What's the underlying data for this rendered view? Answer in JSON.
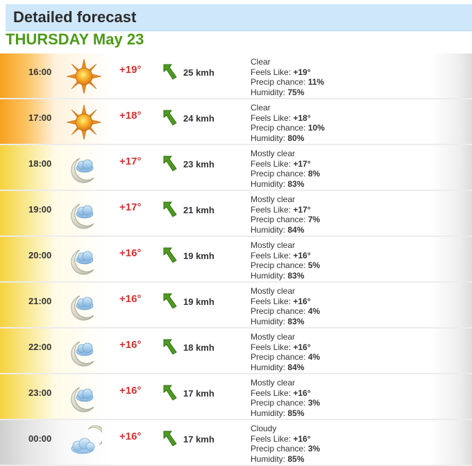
{
  "header": {
    "title": "Detailed forecast"
  },
  "day": {
    "title": "THURSDAY May 23"
  },
  "labels": {
    "feels": "Feels Like: ",
    "precip": "Precip chance: ",
    "humidity": "Humidity: "
  },
  "colors": {
    "temp": "#d0312d",
    "day_title": "#4c9a18",
    "arrow": "#4f9a21"
  },
  "rows": [
    {
      "time": "16:00",
      "icon": "sun-icon",
      "temp": "+19°",
      "wind": "25 kmh",
      "condition": "Clear",
      "feels": "+19°",
      "precip": "11%",
      "humidity": "75%"
    },
    {
      "time": "17:00",
      "icon": "sun-icon",
      "temp": "+18°",
      "wind": "24 kmh",
      "condition": "Clear",
      "feels": "+18°",
      "precip": "10%",
      "humidity": "80%"
    },
    {
      "time": "18:00",
      "icon": "moon-cloud-icon",
      "temp": "+17°",
      "wind": "23 kmh",
      "condition": "Mostly clear",
      "feels": "+17°",
      "precip": "8%",
      "humidity": "83%"
    },
    {
      "time": "19:00",
      "icon": "moon-cloud-icon",
      "temp": "+17°",
      "wind": "21 kmh",
      "condition": "Mostly clear",
      "feels": "+17°",
      "precip": "7%",
      "humidity": "84%"
    },
    {
      "time": "20:00",
      "icon": "moon-cloud-icon",
      "temp": "+16°",
      "wind": "19 kmh",
      "condition": "Mostly clear",
      "feels": "+16°",
      "precip": "5%",
      "humidity": "83%"
    },
    {
      "time": "21:00",
      "icon": "moon-cloud-icon",
      "temp": "+16°",
      "wind": "19 kmh",
      "condition": "Mostly clear",
      "feels": "+16°",
      "precip": "4%",
      "humidity": "83%"
    },
    {
      "time": "22:00",
      "icon": "moon-cloud-icon",
      "temp": "+16°",
      "wind": "18 kmh",
      "condition": "Mostly clear",
      "feels": "+16°",
      "precip": "4%",
      "humidity": "84%"
    },
    {
      "time": "23:00",
      "icon": "moon-cloud-icon",
      "temp": "+16°",
      "wind": "17 kmh",
      "condition": "Mostly clear",
      "feels": "+16°",
      "precip": "3%",
      "humidity": "85%"
    },
    {
      "time": "00:00",
      "icon": "cloudy-moon-icon",
      "temp": "+16°",
      "wind": "17 kmh",
      "condition": "Cloudy",
      "feels": "+16°",
      "precip": "3%",
      "humidity": "85%"
    }
  ]
}
